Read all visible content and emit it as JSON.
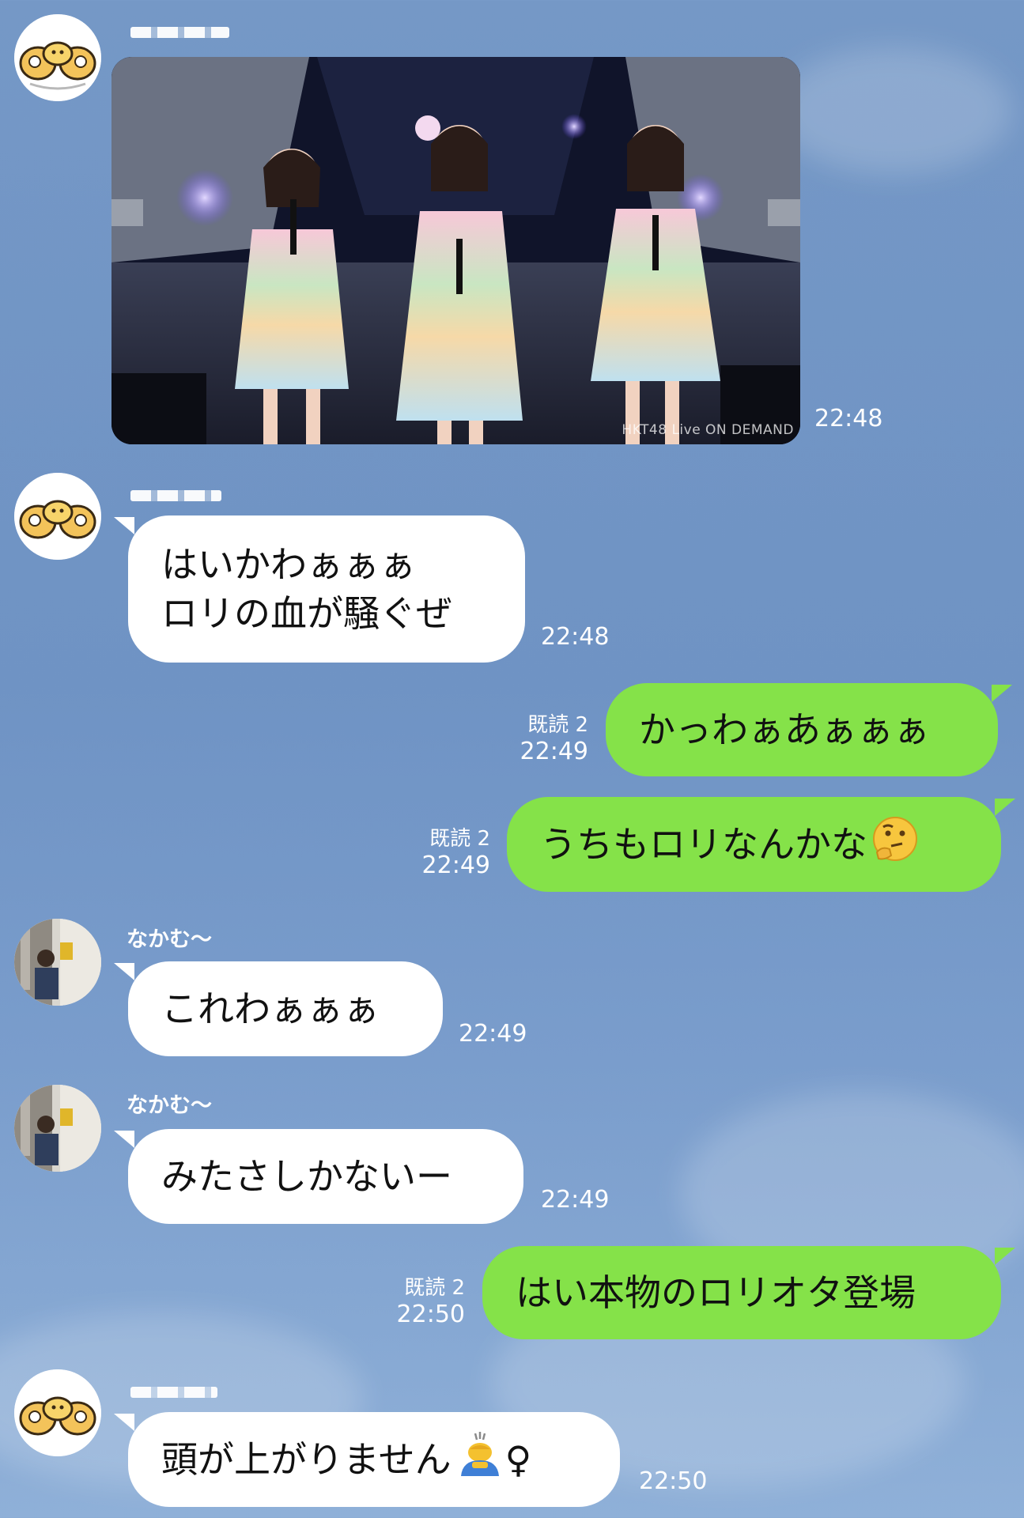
{
  "messages": [
    {
      "type": "image",
      "direction": "in",
      "sender_name": "",
      "watermark": "HKT48 Live ON DEMAND",
      "time": "22:48"
    },
    {
      "type": "text",
      "direction": "in",
      "sender_name": "",
      "lines": [
        "はいかわぁぁぁ",
        "ロリの血が騒ぐぜ"
      ],
      "time": "22:48"
    },
    {
      "type": "text",
      "direction": "out",
      "text": "かっわぁあぁぁぁ",
      "read_label": "既読 2",
      "time": "22:49"
    },
    {
      "type": "text",
      "direction": "out",
      "text": "うちもロリなんかな",
      "emoji": "thinking-face",
      "read_label": "既読 2",
      "time": "22:49"
    },
    {
      "type": "text",
      "direction": "in",
      "sender_name": "なかむ〜",
      "text": "これわぁぁぁ",
      "time": "22:49"
    },
    {
      "type": "text",
      "direction": "in",
      "sender_name": "なかむ〜",
      "text": "みたさしかないー",
      "time": "22:49"
    },
    {
      "type": "text",
      "direction": "out",
      "text": "はい本物のロリオタ登場",
      "read_label": "既読 2",
      "time": "22:50"
    },
    {
      "type": "text",
      "direction": "in",
      "sender_name": "",
      "text": "頭が上がりません",
      "emoji": "person-bowing",
      "suffix": "♀",
      "time": "22:50"
    }
  ],
  "colors": {
    "background": "#7598c6",
    "incoming_bubble": "#ffffff",
    "outgoing_bubble": "#85e249",
    "meta_text": "#ffffff"
  }
}
